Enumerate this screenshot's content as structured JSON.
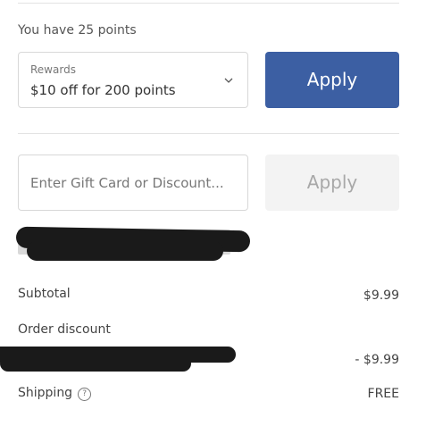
{
  "points": {
    "text": "You have 25 points"
  },
  "rewards": {
    "label": "Rewards",
    "selected": "$10 off for 200 points",
    "apply_label": "Apply"
  },
  "gift_card": {
    "placeholder": "Enter Gift Card or Discount...",
    "value": "",
    "apply_label": "Apply"
  },
  "summary": {
    "subtotal_label": "Subtotal",
    "subtotal_value": "$9.99",
    "discount_label": "Order discount",
    "discount_value": "- $9.99",
    "shipping_label": "Shipping",
    "shipping_help": "?",
    "shipping_value": "FREE"
  },
  "colors": {
    "primary": "#3c5fa3",
    "disabled_bg": "#f3f3f3",
    "border": "#d8d8d8",
    "redaction": "#1a1a1a"
  },
  "icons": {
    "rewards_dropdown": "chevron-down-icon",
    "shipping_help": "question-circle-icon"
  }
}
